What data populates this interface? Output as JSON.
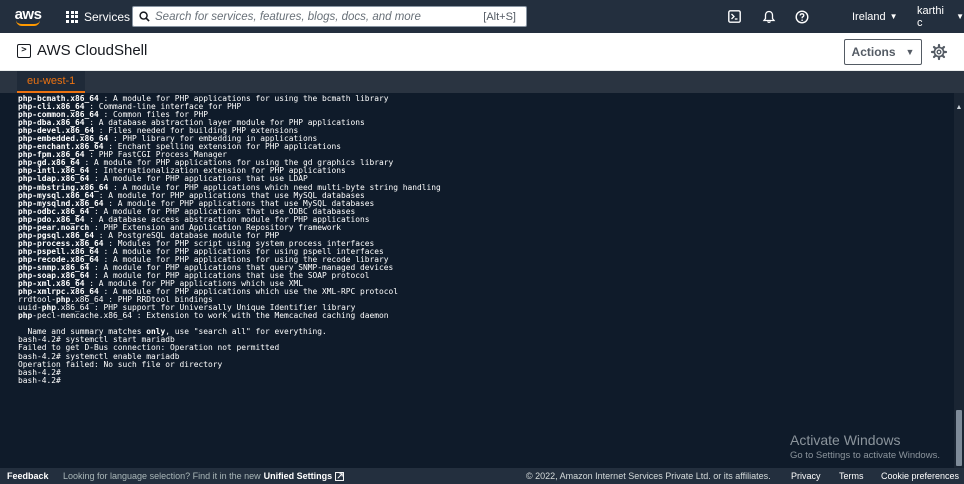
{
  "topnav": {
    "logo_text": "aws",
    "services_label": "Services",
    "search_placeholder": "Search for services, features, blogs, docs, and more",
    "search_shortcut": "[Alt+S]",
    "region_label": "Ireland",
    "user_label": "karthi c"
  },
  "header": {
    "title": "AWS CloudShell",
    "actions_label": "Actions"
  },
  "tabs": [
    {
      "label": "eu-west-1"
    }
  ],
  "terminal": {
    "lines": [
      [
        {
          "t": "php-bcmath.x86_64",
          "b": true
        },
        {
          "t": " : A module for PHP applications for using the bcmath library"
        }
      ],
      [
        {
          "t": "php-cli.x86_64",
          "b": true
        },
        {
          "t": " : Command-line interface for PHP"
        }
      ],
      [
        {
          "t": "php-common.x86_64",
          "b": true
        },
        {
          "t": " : Common files for PHP"
        }
      ],
      [
        {
          "t": "php-dba.x86_64",
          "b": true
        },
        {
          "t": " : A database abstraction layer module for PHP applications"
        }
      ],
      [
        {
          "t": "php-devel.x86_64",
          "b": true
        },
        {
          "t": " : Files needed for building PHP extensions"
        }
      ],
      [
        {
          "t": "php-embedded.x86_64",
          "b": true
        },
        {
          "t": " : PHP library for embedding in applications"
        }
      ],
      [
        {
          "t": "php-enchant.x86_64",
          "b": true
        },
        {
          "t": " : Enchant spelling extension for PHP applications"
        }
      ],
      [
        {
          "t": "php-fpm.x86_64",
          "b": true
        },
        {
          "t": " : PHP FastCGI Process Manager"
        }
      ],
      [
        {
          "t": "php-gd.x86_64",
          "b": true
        },
        {
          "t": " : A module for PHP applications for using the gd graphics library"
        }
      ],
      [
        {
          "t": "php-intl.x86_64",
          "b": true
        },
        {
          "t": " : Internationalization extension for PHP applications"
        }
      ],
      [
        {
          "t": "php-ldap.x86_64",
          "b": true
        },
        {
          "t": " : A module for PHP applications that use LDAP"
        }
      ],
      [
        {
          "t": "php-mbstring.x86_64",
          "b": true
        },
        {
          "t": " : A module for PHP applications which need multi-byte string handling"
        }
      ],
      [
        {
          "t": "php-mysql.x86_64",
          "b": true
        },
        {
          "t": " : A module for PHP applications that use MySQL databases"
        }
      ],
      [
        {
          "t": "php-mysqlnd.x86_64",
          "b": true
        },
        {
          "t": " : A module for PHP applications that use MySQL databases"
        }
      ],
      [
        {
          "t": "php-odbc.x86_64",
          "b": true
        },
        {
          "t": " : A module for PHP applications that use ODBC databases"
        }
      ],
      [
        {
          "t": "php-pdo.x86_64",
          "b": true
        },
        {
          "t": " : A database access abstraction module for PHP applications"
        }
      ],
      [
        {
          "t": "php-pear.noarch",
          "b": true
        },
        {
          "t": " : PHP Extension and Application Repository framework"
        }
      ],
      [
        {
          "t": "php-pgsql.x86_64",
          "b": true
        },
        {
          "t": " : A PostgreSQL database module for PHP"
        }
      ],
      [
        {
          "t": "php-process.x86_64",
          "b": true
        },
        {
          "t": " : Modules for PHP script using system process interfaces"
        }
      ],
      [
        {
          "t": "php-pspell.x86_64",
          "b": true
        },
        {
          "t": " : A module for PHP applications for using pspell interfaces"
        }
      ],
      [
        {
          "t": "php-recode.x86_64",
          "b": true
        },
        {
          "t": " : A module for PHP applications for using the recode library"
        }
      ],
      [
        {
          "t": "php-snmp.x86_64",
          "b": true
        },
        {
          "t": " : A module for PHP applications that query SNMP-managed devices"
        }
      ],
      [
        {
          "t": "php-soap.x86_64",
          "b": true
        },
        {
          "t": " : A module for PHP applications that use the SOAP protocol"
        }
      ],
      [
        {
          "t": "php-xml.x86_64",
          "b": true
        },
        {
          "t": " : A module for PHP applications which use XML"
        }
      ],
      [
        {
          "t": "php-xmlrpc.x86_64",
          "b": true
        },
        {
          "t": " : A module for PHP applications which use the XML-RPC protocol"
        }
      ],
      [
        {
          "t": "rrdtool-"
        },
        {
          "t": "php",
          "b": true
        },
        {
          "t": ".x86_64 : PHP RRDtool bindings"
        }
      ],
      [
        {
          "t": "uuid-"
        },
        {
          "t": "php",
          "b": true
        },
        {
          "t": ".x86_64 : PHP support for Universally Unique Identifier library"
        }
      ],
      [
        {
          "t": "php",
          "b": true
        },
        {
          "t": "-pecl-memcache.x86_64 : Extension to work with the Memcached caching daemon"
        }
      ],
      [
        {
          "t": ""
        }
      ],
      [
        {
          "t": "  Name and summary matches "
        },
        {
          "t": "only",
          "b": true
        },
        {
          "t": ", use \"search all\" for everything."
        }
      ],
      [
        {
          "t": "bash-4.2# systemctl start mariadb"
        }
      ],
      [
        {
          "t": "Failed to get D-Bus connection: Operation not permitted"
        }
      ],
      [
        {
          "t": "bash-4.2# systemctl enable mariadb"
        }
      ],
      [
        {
          "t": "Operation failed: No such file or directory"
        }
      ],
      [
        {
          "t": "bash-4.2#"
        }
      ],
      [
        {
          "t": "bash-4.2#"
        }
      ]
    ]
  },
  "watermark": {
    "title": "Activate Windows",
    "subtitle": "Go to Settings to activate Windows."
  },
  "footer": {
    "feedback": "Feedback",
    "language_prompt": "Looking for language selection? Find it in the new",
    "unified_settings": "Unified Settings",
    "copyright": "© 2022, Amazon Internet Services Private Ltd. or its affiliates.",
    "privacy": "Privacy",
    "terms": "Terms",
    "cookie": "Cookie preferences"
  },
  "colors": {
    "nav_bg": "#232f3e",
    "terminal_bg": "#0f1b2a",
    "accent_orange": "#ec7211",
    "logo_smile": "#ff9900"
  }
}
